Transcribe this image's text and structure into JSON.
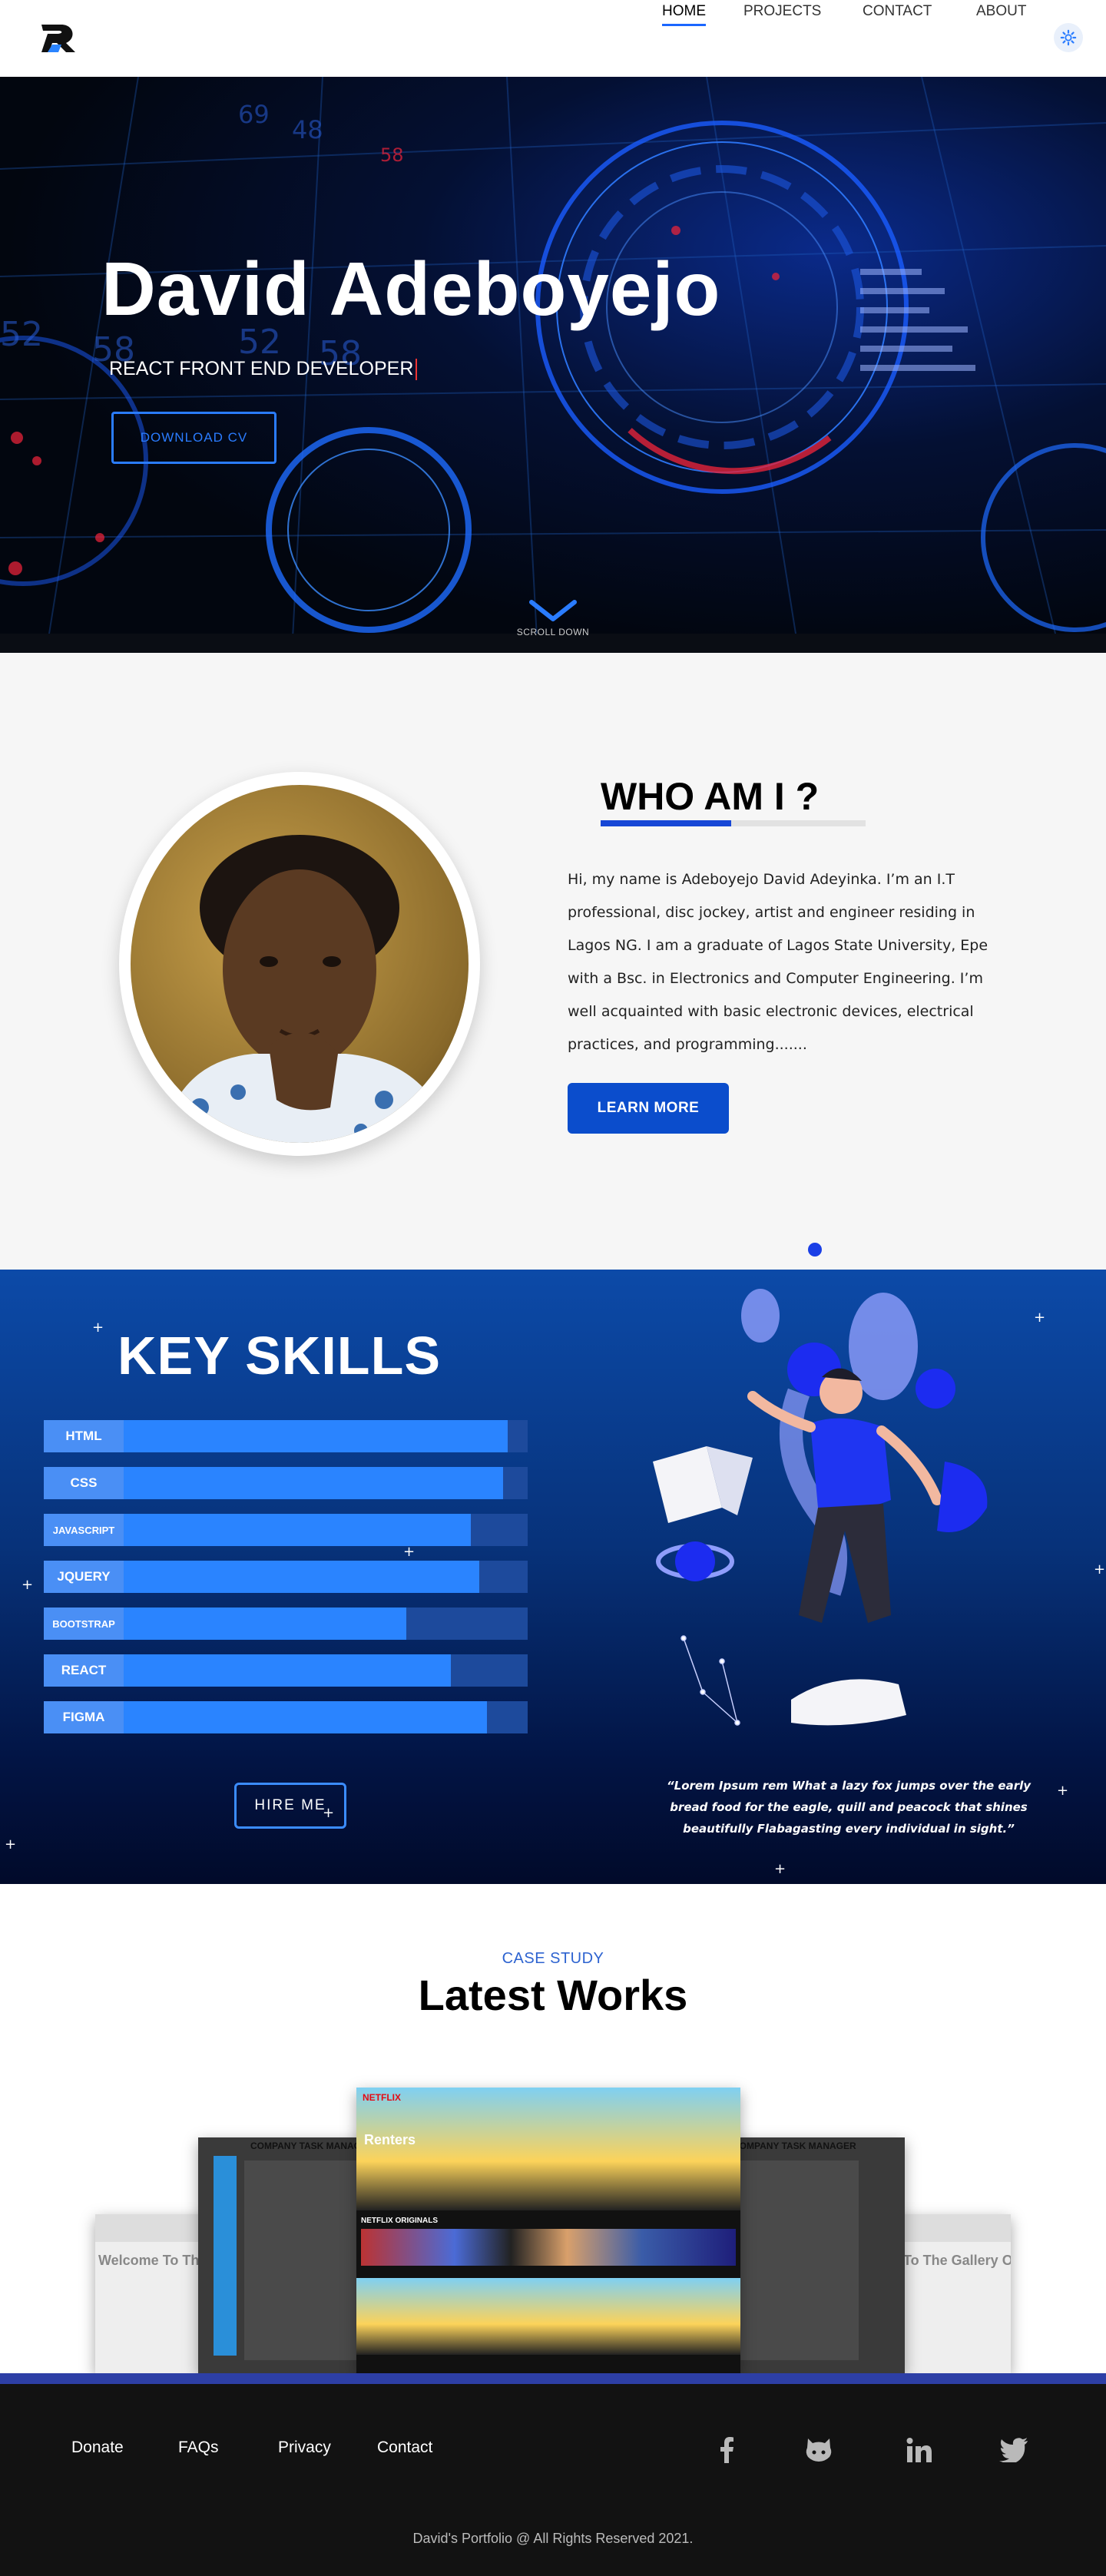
{
  "nav": {
    "logo_icon": "dr-logo-icon",
    "links": [
      "HOME",
      "PROJECTS",
      "CONTACT",
      "ABOUT"
    ],
    "active": "HOME",
    "settings_icon": "gear-icon"
  },
  "hero": {
    "name": "David  Adeboyejo",
    "role": "REACT FRONT END DEVELOPER",
    "download_label": "DOWNLOAD  CV",
    "scroll_label": "SCROLL DOWN",
    "scroll_icon": "chevron-down-icon",
    "accent_color": "#2a7cff"
  },
  "about": {
    "title": "WHO AM I ?",
    "text": "Hi, my name is Adeboyejo David Adeyinka. I’m an I.T professional, disc jockey, artist and engineer residing in Lagos NG. I am a graduate of Lagos State University, Epe with a Bsc. in Electronics and Computer Engineering. I’m well acquainted with basic electronic devices, electrical practices,  and programming.......",
    "learn_more_label": "LEARN MORE",
    "button_color": "#0b4dcc"
  },
  "skills": {
    "title": "KEY SKILLS",
    "items": [
      {
        "name": "HTML",
        "level": 0.95
      },
      {
        "name": "CSS",
        "level": 0.94
      },
      {
        "name": "JAVASCRIPT",
        "level": 0.86
      },
      {
        "name": "JQUERY",
        "level": 0.88
      },
      {
        "name": "BOOTSTRAP",
        "level": 0.7
      },
      {
        "name": "REACT",
        "level": 0.81
      },
      {
        "name": "FIGMA",
        "level": 0.9
      }
    ],
    "hire_label": "HIRE  ME",
    "quote": "“Lorem Ipsum rem What a lazy fox jumps over the early bread food for the eagle, quill and peacock that shines beautifully Flabagasting every individual in sight.”"
  },
  "works": {
    "eyebrow": "CASE STUDY",
    "title": "Latest Works",
    "shots": {
      "gallery_left": "Welcome To The Gallery Of SAMMIE'S ART",
      "gallery_right": "To The Gallery Of SAMMIE'S ART",
      "task_title": "COMPANY TASK MANAGER",
      "netflix_brand": "NETFLIX",
      "netflix_title": "Renters",
      "netflix_row": "NETFLIX ORIGINALS"
    }
  },
  "footer": {
    "links": [
      "Donate",
      "FAQs",
      "Privacy",
      "Contact"
    ],
    "socials": [
      "facebook-icon",
      "github-icon",
      "linkedin-icon",
      "twitter-icon"
    ],
    "copyright": "David's Portfolio @ All Rights Reserved 2021."
  }
}
